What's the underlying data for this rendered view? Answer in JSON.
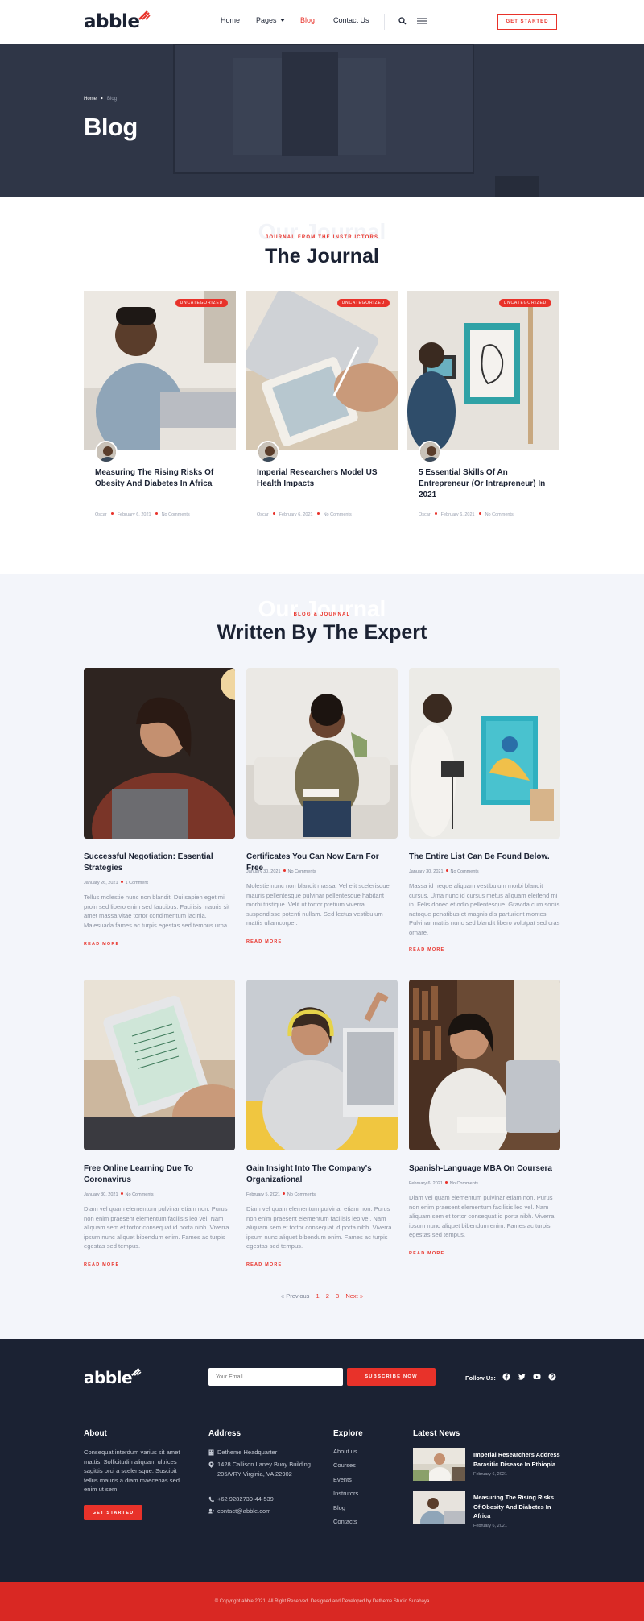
{
  "brand": {
    "logo_text": "abble",
    "accent": "#e8322a",
    "dark": "#1b2233"
  },
  "nav": {
    "items": [
      {
        "label": "Home"
      },
      {
        "label": "Pages"
      },
      {
        "label": "Blog"
      },
      {
        "label": "Contact Us"
      }
    ],
    "cta": "GET STARTED"
  },
  "hero": {
    "breadcrumb": {
      "home": "Home",
      "current": "Blog"
    },
    "title": "Blog"
  },
  "journal": {
    "ghost": "Our Journal",
    "kicker": "JOURNAL FROM THE INSTRUCTORS",
    "title": "The Journal",
    "cards": [
      {
        "badge": "UNCATEGORIZED",
        "title": "Measuring The Rising Risks Of Obesity And Diabetes In Africa",
        "author": "Oscar",
        "date": "February 6, 2021",
        "comments": "No Comments"
      },
      {
        "badge": "UNCATEGORIZED",
        "title": "Imperial Researchers Model US Health Impacts",
        "author": "Oscar",
        "date": "February 6, 2021",
        "comments": "No Comments"
      },
      {
        "badge": "UNCATEGORIZED",
        "title": "5 Essential Skills Of An Entrepreneur (Or Intrapreneur) In 2021",
        "author": "Oscar",
        "date": "February 6, 2021",
        "comments": "No Comments"
      }
    ]
  },
  "expert": {
    "ghost": "Our Journal",
    "kicker": "BLOG & JOURNAL",
    "title": "Written By The Expert",
    "read_more": "READ MORE",
    "posts": [
      {
        "title": "Successful Negotiation: Essential Strategies",
        "date": "January 26, 2021",
        "comments": "1 Comment",
        "excerpt": "Tellus molestie nunc non blandit. Dui sapien eget mi proin sed libero enim sed faucibus. Facilisis mauris sit amet massa vitae tortor condimentum lacinia. Malesuada fames ac turpis egestas sed tempus urna."
      },
      {
        "title": "Certificates You Can Now Earn For Free",
        "date": "January 30, 2021",
        "comments": "No Comments",
        "excerpt": "Molestie nunc non blandit massa. Vel elit scelerisque mauris pellentesque pulvinar pellentesque habitant morbi tristique. Velit ut tortor pretium viverra suspendisse potenti nullam. Sed lectus vestibulum mattis ullamcorper."
      },
      {
        "title": "The Entire List Can Be Found Below.",
        "date": "January 30, 2021",
        "comments": "No Comments",
        "excerpt": "Massa id neque aliquam vestibulum morbi blandit cursus. Urna nunc id cursus metus aliquam eleifend mi in. Felis donec et odio pellentesque. Gravida cum sociis natoque penatibus et magnis dis parturient montes. Pulvinar mattis nunc sed blandit libero volutpat sed cras ornare."
      },
      {
        "title": "Free Online Learning Due To Coronavirus",
        "date": "January 30, 2021",
        "comments": "No Comments",
        "excerpt": "Diam vel quam elementum pulvinar etiam non. Purus non enim praesent elementum facilisis leo vel. Nam aliquam sem et tortor consequat id porta nibh. Viverra ipsum nunc aliquet bibendum enim. Fames ac turpis egestas sed tempus."
      },
      {
        "title": "Gain Insight Into The Company's Organizational",
        "date": "February 5, 2021",
        "comments": "No Comments",
        "excerpt": "Diam vel quam elementum pulvinar etiam non. Purus non enim praesent elementum facilisis leo vel. Nam aliquam sem et tortor consequat id porta nibh. Viverra ipsum nunc aliquet bibendum enim. Fames ac turpis egestas sed tempus."
      },
      {
        "title": "Spanish-Language MBA On Coursera",
        "date": "February 6, 2021",
        "comments": "No Comments",
        "excerpt": "Diam vel quam elementum pulvinar etiam non. Purus non enim praesent elementum facilisis leo vel. Nam aliquam sem et tortor consequat id porta nibh. Viverra ipsum nunc aliquet bibendum enim. Fames ac turpis egestas sed tempus."
      }
    ],
    "pagination": {
      "prev": "« Previous",
      "pages": [
        "1",
        "2",
        "3"
      ],
      "next": "Next »"
    }
  },
  "footer": {
    "logo_text": "abble",
    "email_placeholder": "Your Email",
    "subscribe": "SUBSCRIBE NOW",
    "follow": "Follow Us:",
    "social_icons": [
      "facebook-icon",
      "twitter-icon",
      "youtube-icon",
      "pinterest-icon"
    ],
    "about": {
      "heading": "About",
      "text": "Consequat interdum varius sit amet mattis. Sollicitudin aliquam ultrices sagittis orci a scelerisque. Suscipit tellus mauris a diam maecenas sed enim ut sem",
      "cta": "GET STARTED"
    },
    "address": {
      "heading": "Address",
      "hq": "Detheme Headquarter",
      "street": "1428 Callison Laney Buoy Building 205/VRY Virginia, VA 22902",
      "phone": "+62 9282739-44-539",
      "email": "contact@abble.com"
    },
    "explore": {
      "heading": "Explore",
      "links": [
        "About us",
        "Courses",
        "Events",
        "Instrutors",
        "Blog",
        "Contacts"
      ]
    },
    "news": {
      "heading": "Latest News",
      "items": [
        {
          "title": "Imperial Researchers Address Parasitic Disease In Ethiopia",
          "date": "February 6, 2021"
        },
        {
          "title": "Measuring The Rising Risks Of Obesity And Diabetes In Africa",
          "date": "February 6, 2021"
        }
      ]
    },
    "copyright": "© Copyright abble 2021. All Right Reserved. Designed and Developed by Detheme Studio Surabaya"
  }
}
